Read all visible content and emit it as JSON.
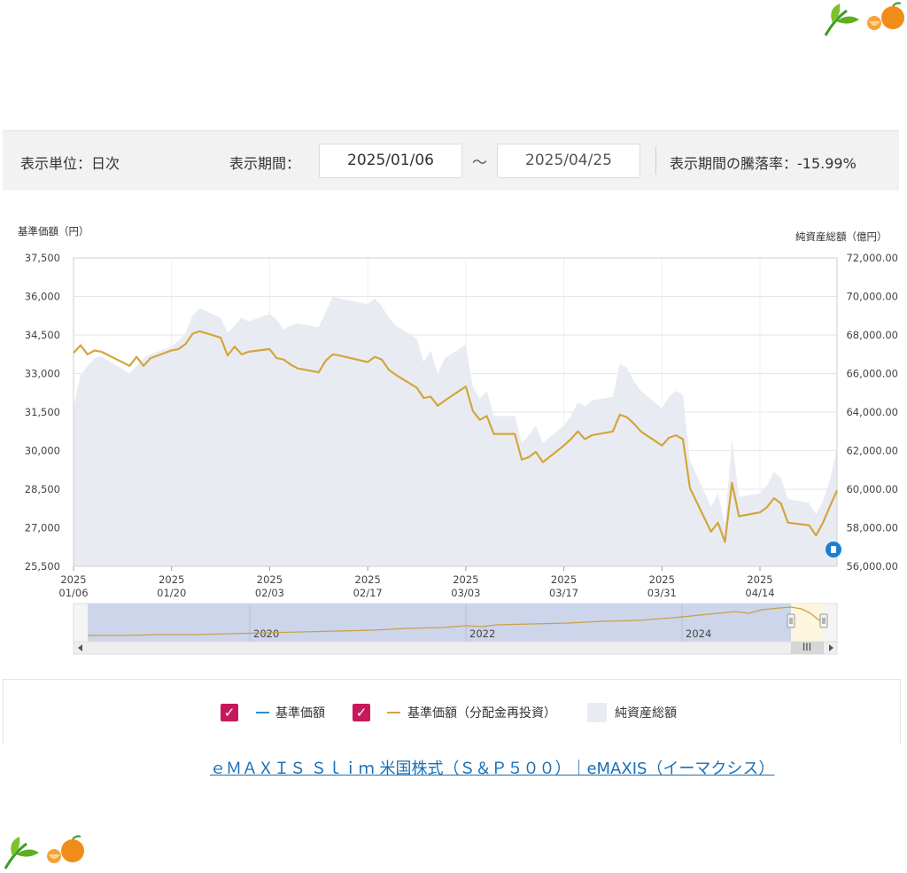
{
  "controls": {
    "unit_label": "表示単位：日次",
    "period_label": "表示期間：",
    "start_date": "2025/01/06",
    "separator": "～",
    "end_date": "2025/04/25",
    "change_label": "表示期間の騰落率：-15.99%"
  },
  "chart_data": {
    "type": "line",
    "left_axis_title": "基準価額（円）",
    "right_axis_title": "純資産総額（億円）",
    "y_left": {
      "ylim": [
        25500,
        37500
      ],
      "ticks": [
        "37,500",
        "36,000",
        "34,500",
        "33,000",
        "31,500",
        "30,000",
        "28,500",
        "27,000",
        "25,500"
      ]
    },
    "y_right": {
      "ylim": [
        56000,
        72000
      ],
      "ticks": [
        "72,000.00",
        "70,000.00",
        "68,000.00",
        "66,000.00",
        "64,000.00",
        "62,000.00",
        "60,000.00",
        "58,000.00",
        "56,000.00"
      ]
    },
    "x_ticks": [
      {
        "year": "2025",
        "date": "01/06"
      },
      {
        "year": "2025",
        "date": "01/20"
      },
      {
        "year": "2025",
        "date": "02/03"
      },
      {
        "year": "2025",
        "date": "02/17"
      },
      {
        "year": "2025",
        "date": "03/03"
      },
      {
        "year": "2025",
        "date": "03/17"
      },
      {
        "year": "2025",
        "date": "03/31"
      },
      {
        "year": "2025",
        "date": "04/14"
      }
    ],
    "grid": true,
    "series": [
      {
        "name": "基準価額（分配金再投資）",
        "axis": "left",
        "color": "#d4a53c",
        "points": [
          [
            "01/06",
            33800
          ],
          [
            "01/07",
            34100
          ],
          [
            "01/08",
            33750
          ],
          [
            "01/09",
            33900
          ],
          [
            "01/10",
            33850
          ],
          [
            "01/14",
            33300
          ],
          [
            "01/15",
            33650
          ],
          [
            "01/16",
            33300
          ],
          [
            "01/17",
            33600
          ],
          [
            "01/20",
            33900
          ],
          [
            "01/21",
            33950
          ],
          [
            "01/22",
            34150
          ],
          [
            "01/23",
            34550
          ],
          [
            "01/24",
            34650
          ],
          [
            "01/27",
            34400
          ],
          [
            "01/28",
            33700
          ],
          [
            "01/29",
            34050
          ],
          [
            "01/30",
            33750
          ],
          [
            "01/31",
            33850
          ],
          [
            "02/03",
            33950
          ],
          [
            "02/04",
            33600
          ],
          [
            "02/05",
            33550
          ],
          [
            "02/06",
            33350
          ],
          [
            "02/07",
            33200
          ],
          [
            "02/10",
            33050
          ],
          [
            "02/11",
            33500
          ],
          [
            "02/12",
            33750
          ],
          [
            "02/13",
            33700
          ],
          [
            "02/17",
            33450
          ],
          [
            "02/18",
            33650
          ],
          [
            "02/19",
            33550
          ],
          [
            "02/20",
            33150
          ],
          [
            "02/21",
            32950
          ],
          [
            "02/24",
            32450
          ],
          [
            "02/25",
            32050
          ],
          [
            "02/26",
            32100
          ],
          [
            "02/27",
            31750
          ],
          [
            "02/28",
            31950
          ],
          [
            "03/03",
            32500
          ],
          [
            "03/04",
            31550
          ],
          [
            "03/05",
            31200
          ],
          [
            "03/06",
            31350
          ],
          [
            "03/07",
            30650
          ],
          [
            "03/10",
            30650
          ],
          [
            "03/11",
            29650
          ],
          [
            "03/12",
            29750
          ],
          [
            "03/13",
            29950
          ],
          [
            "03/14",
            29550
          ],
          [
            "03/17",
            30200
          ],
          [
            "03/18",
            30450
          ],
          [
            "03/19",
            30750
          ],
          [
            "03/20",
            30450
          ],
          [
            "03/21",
            30600
          ],
          [
            "03/24",
            30750
          ],
          [
            "03/25",
            31400
          ],
          [
            "03/26",
            31300
          ],
          [
            "03/27",
            31050
          ],
          [
            "03/28",
            30750
          ],
          [
            "03/31",
            30200
          ],
          [
            "04/01",
            30500
          ],
          [
            "04/02",
            30600
          ],
          [
            "04/03",
            30450
          ],
          [
            "04/04",
            28550
          ],
          [
            "04/07",
            26850
          ],
          [
            "04/08",
            27200
          ],
          [
            "04/09",
            26450
          ],
          [
            "04/10",
            28750
          ],
          [
            "04/11",
            27450
          ],
          [
            "04/14",
            27600
          ],
          [
            "04/15",
            27800
          ],
          [
            "04/16",
            28150
          ],
          [
            "04/17",
            27950
          ],
          [
            "04/18",
            27200
          ],
          [
            "04/21",
            27100
          ],
          [
            "04/22",
            26700
          ],
          [
            "04/23",
            27200
          ],
          [
            "04/24",
            27850
          ],
          [
            "04/25",
            28450
          ]
        ]
      },
      {
        "name": "純資産総額",
        "axis": "right",
        "color": "#e8ecf2",
        "points": [
          [
            "01/06",
            64300
          ],
          [
            "01/07",
            65900
          ],
          [
            "01/08",
            66400
          ],
          [
            "01/09",
            66800
          ],
          [
            "01/10",
            66900
          ],
          [
            "01/14",
            66000
          ],
          [
            "01/15",
            66400
          ],
          [
            "01/16",
            66800
          ],
          [
            "01/17",
            67000
          ],
          [
            "01/20",
            67400
          ],
          [
            "01/21",
            67700
          ],
          [
            "01/22",
            68100
          ],
          [
            "01/23",
            69000
          ],
          [
            "01/24",
            69400
          ],
          [
            "01/27",
            68900
          ],
          [
            "01/28",
            68100
          ],
          [
            "01/29",
            68500
          ],
          [
            "01/30",
            68900
          ],
          [
            "01/31",
            68700
          ],
          [
            "02/03",
            69100
          ],
          [
            "02/04",
            68800
          ],
          [
            "02/05",
            68300
          ],
          [
            "02/06",
            68500
          ],
          [
            "02/07",
            68600
          ],
          [
            "02/10",
            68400
          ],
          [
            "02/11",
            69200
          ],
          [
            "02/12",
            70000
          ],
          [
            "02/13",
            69900
          ],
          [
            "02/17",
            69600
          ],
          [
            "02/18",
            69900
          ],
          [
            "02/19",
            69500
          ],
          [
            "02/20",
            68900
          ],
          [
            "02/21",
            68500
          ],
          [
            "02/24",
            67800
          ],
          [
            "02/25",
            66600
          ],
          [
            "02/26",
            67200
          ],
          [
            "02/27",
            66000
          ],
          [
            "02/28",
            66800
          ],
          [
            "03/03",
            67500
          ],
          [
            "03/04",
            65300
          ],
          [
            "03/05",
            64700
          ],
          [
            "03/06",
            65100
          ],
          [
            "03/07",
            63800
          ],
          [
            "03/10",
            63800
          ],
          [
            "03/11",
            62400
          ],
          [
            "03/12",
            62800
          ],
          [
            "03/13",
            63300
          ],
          [
            "03/14",
            62400
          ],
          [
            "03/17",
            63300
          ],
          [
            "03/18",
            63800
          ],
          [
            "03/19",
            64500
          ],
          [
            "03/20",
            64300
          ],
          [
            "03/21",
            64600
          ],
          [
            "03/24",
            64800
          ],
          [
            "03/25",
            66500
          ],
          [
            "03/26",
            66300
          ],
          [
            "03/27",
            65600
          ],
          [
            "03/28",
            65100
          ],
          [
            "03/31",
            64200
          ],
          [
            "04/01",
            64800
          ],
          [
            "04/02",
            65100
          ],
          [
            "04/03",
            64900
          ],
          [
            "04/04",
            61500
          ],
          [
            "04/07",
            59100
          ],
          [
            "04/08",
            59800
          ],
          [
            "04/09",
            58200
          ],
          [
            "04/10",
            62600
          ],
          [
            "04/11",
            59600
          ],
          [
            "04/14",
            59800
          ],
          [
            "04/15",
            60200
          ],
          [
            "04/16",
            60900
          ],
          [
            "04/17",
            60600
          ],
          [
            "04/18",
            59500
          ],
          [
            "04/21",
            59300
          ],
          [
            "04/22",
            58700
          ],
          [
            "04/23",
            59400
          ],
          [
            "04/24",
            60500
          ],
          [
            "04/25",
            62200
          ]
        ]
      }
    ],
    "navigator": {
      "labels": [
        "2020",
        "2022",
        "2024"
      ]
    }
  },
  "legend": {
    "items": [
      {
        "label": "基準価額",
        "color": "#2a8fd6"
      },
      {
        "label": "基準価額（分配金再投資）",
        "color": "#d4a53c"
      },
      {
        "label": "純資産総額",
        "color": "#e8ecf2"
      }
    ]
  },
  "link": {
    "text": "ｅＭＡＸＩＳ Ｓｌｉｍ 米国株式（Ｓ＆Ｐ５００）｜eMAXIS（イーマクシス）"
  },
  "colors": {
    "accent": "#c8185c",
    "link": "#1a6fb5",
    "grid": "#e6e6e6"
  }
}
